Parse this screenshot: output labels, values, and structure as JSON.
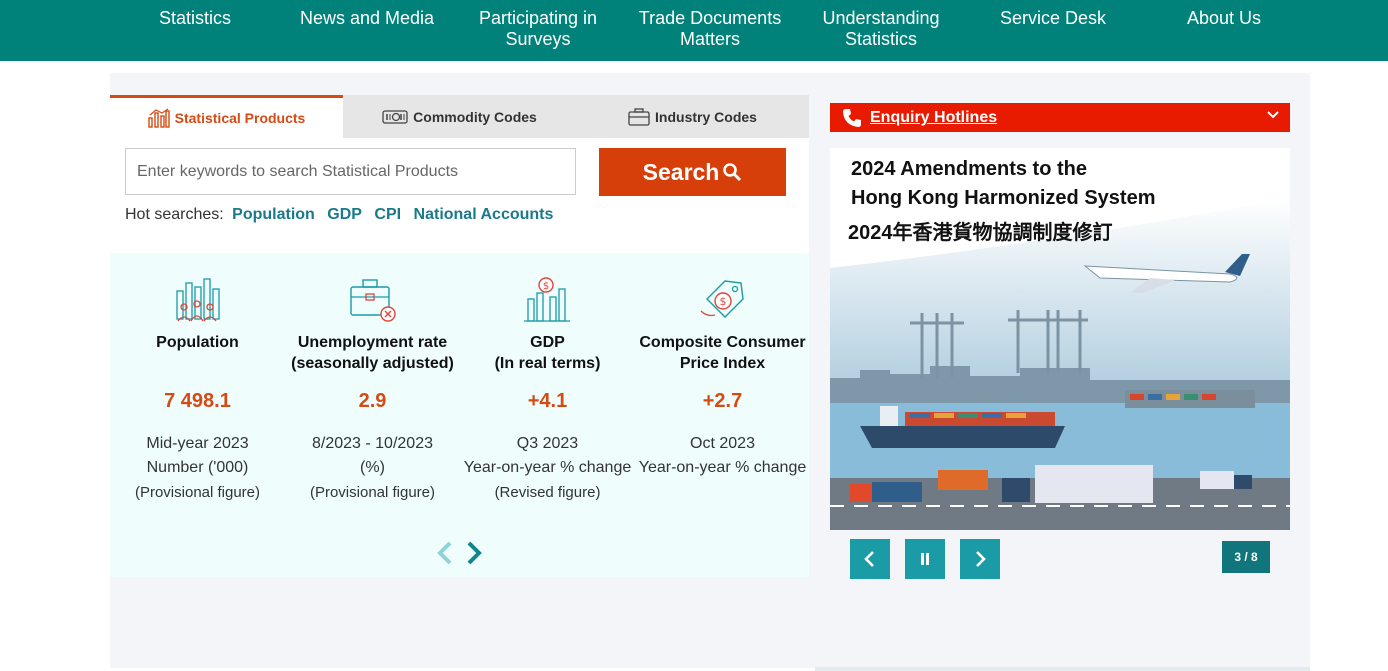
{
  "nav": {
    "items": [
      {
        "line1": "Statistics",
        "line2": ""
      },
      {
        "line1": "News and Media",
        "line2": ""
      },
      {
        "line1": "Participating in",
        "line2": "Surveys"
      },
      {
        "line1": "Trade Documents",
        "line2": "Matters"
      },
      {
        "line1": "Understanding",
        "line2": "Statistics"
      },
      {
        "line1": "Service Desk",
        "line2": ""
      },
      {
        "line1": "About Us",
        "line2": ""
      }
    ]
  },
  "tabs": [
    {
      "label": "Statistical Products",
      "icon": "bar-chart-icon",
      "active": true
    },
    {
      "label": "Commodity Codes",
      "icon": "barcode-icon",
      "active": false
    },
    {
      "label": "Industry Codes",
      "icon": "briefcase-icon",
      "active": false
    }
  ],
  "search": {
    "placeholder": "Enter keywords to search Statistical Products",
    "button_label": "Search",
    "hot_label": "Hot searches:",
    "hot_terms": [
      "Population",
      "GDP",
      "CPI",
      "National Accounts"
    ]
  },
  "stats": [
    {
      "name1": "Population",
      "name2": "",
      "value": "7 498.1",
      "line1": "Mid-year 2023",
      "line2": "Number ('000)",
      "line3": "(Provisional figure)",
      "icon": "population-icon"
    },
    {
      "name1": "Unemployment rate",
      "name2": "(seasonally adjusted)",
      "value": "2.9",
      "line1": "8/2023 - 10/2023",
      "line2": "(%)",
      "line3": "(Provisional figure)",
      "icon": "briefcase-cancel-icon"
    },
    {
      "name1": "GDP",
      "name2": "(In real terms)",
      "value": "+4.1",
      "line1": "Q3 2023",
      "line2": "Year-on-year % change",
      "line3": "(Revised figure)",
      "icon": "dollar-chart-icon"
    },
    {
      "name1": "Composite Consumer",
      "name2": "Price Index",
      "value": "+2.7",
      "line1": "Oct 2023",
      "line2": "Year-on-year % change",
      "line3": "",
      "icon": "price-tag-icon"
    }
  ],
  "hotline": {
    "label": "Enquiry Hotlines"
  },
  "banner": {
    "title1": "2024 Amendments to the",
    "title2": "Hong Kong Harmonized System",
    "title3": "2024年香港貨物協調制度修訂"
  },
  "carousel": {
    "counter": "3 / 8"
  },
  "colors": {
    "nav": "#00827a",
    "accent": "#d64a14",
    "teal": "#1a9ba5",
    "hotline": "#e81b00"
  }
}
